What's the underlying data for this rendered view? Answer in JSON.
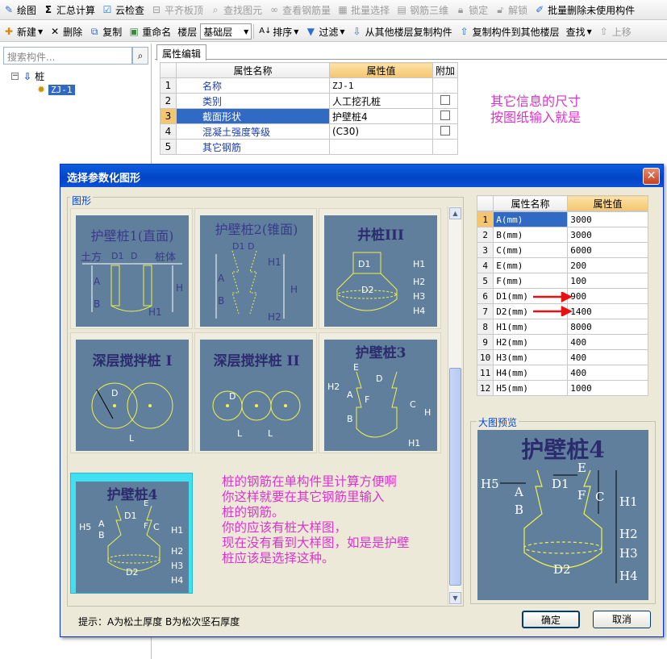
{
  "toolbar1": {
    "items": [
      {
        "label": "绘图",
        "icon": "draw-icon",
        "disabled": false
      },
      {
        "label": "汇总计算",
        "icon": "sigma-icon",
        "disabled": false
      },
      {
        "label": "云检查",
        "icon": "cloud-check-icon",
        "disabled": false
      },
      {
        "label": "平齐板顶",
        "icon": "align-top-icon",
        "disabled": true
      },
      {
        "label": "查找图元",
        "icon": "find-icon",
        "disabled": true
      },
      {
        "label": "查看钢筋量",
        "icon": "rebar-icon",
        "disabled": true
      },
      {
        "label": "批量选择",
        "icon": "batch-select-icon",
        "disabled": true
      },
      {
        "label": "钢筋三维",
        "icon": "rebar-3d-icon",
        "disabled": true
      },
      {
        "label": "锁定",
        "icon": "lock-icon",
        "disabled": true
      },
      {
        "label": "解锁",
        "icon": "unlock-icon",
        "disabled": true
      },
      {
        "label": "批量删除未使用构件",
        "icon": "batch-delete-icon",
        "disabled": false
      }
    ]
  },
  "toolbar2": {
    "new_label": "新建",
    "delete_label": "删除",
    "copy_label": "复制",
    "rename_label": "重命名",
    "floor_label": "楼层",
    "floor_value": "基础层",
    "sort_label": "排序",
    "filter_label": "过滤",
    "copy_from_label": "从其他楼层复制构件",
    "copy_to_label": "复制构件到其他楼层",
    "find_label": "查找",
    "up_label": "上移"
  },
  "left_panel": {
    "search_placeholder": "搜索构件...",
    "tree_root": "桩",
    "tree_child": "ZJ-1"
  },
  "main": {
    "tab_label": "属性编辑",
    "prop_headers": {
      "name": "属性名称",
      "value": "属性值",
      "extra": "附加"
    },
    "prop_rows": [
      {
        "num": "1",
        "name": "名称",
        "value": "ZJ-1"
      },
      {
        "num": "2",
        "name": "类别",
        "value": "人工挖孔桩"
      },
      {
        "num": "3",
        "name": "截面形状",
        "value": "护壁桩4"
      },
      {
        "num": "4",
        "name": "混凝土强度等级",
        "value": "(C30)"
      },
      {
        "num": "5",
        "name": "其它钢筋",
        "value": ""
      }
    ],
    "annotation": "其它信息的尺寸\n按图纸输入就是"
  },
  "dialog": {
    "title": "选择参数化图形",
    "shapes_label": "图形",
    "shapes": [
      {
        "title": "护壁桩1(直面)",
        "labels": [
          "土方",
          "D1",
          "D",
          "桩体",
          "A",
          "B",
          "H",
          "H1"
        ]
      },
      {
        "title": "护壁桩2(锥面)",
        "labels": [
          "D1",
          "D",
          "H1",
          "A",
          "B",
          "H",
          "H2"
        ]
      },
      {
        "title": "井桩III",
        "labels": [
          "D1",
          "D2",
          "H1",
          "H2",
          "H3",
          "H4"
        ]
      },
      {
        "title": "深层搅拌桩 I",
        "labels": [
          "D",
          "L"
        ]
      },
      {
        "title": "深层搅拌桩 II",
        "labels": [
          "D",
          "L",
          "L"
        ]
      },
      {
        "title": "护壁桩3",
        "labels": [
          "E",
          "D",
          "H2",
          "A",
          "F",
          "C",
          "B",
          "H",
          "H1"
        ]
      },
      {
        "title": "护壁桩4",
        "labels": [
          "E",
          "D1",
          "H5",
          "A",
          "F",
          "C",
          "B",
          "H1",
          "H2",
          "H3",
          "H4",
          "D2"
        ]
      }
    ],
    "annotation": "桩的钢筋在单构件里计算方便啊\n你这样就要在其它钢筋里输入\n桩的钢筋。\n你的应该有桩大样图，\n现在没有看到大样图，如是是护壁\n桩应该是选择这种。",
    "param_headers": {
      "name": "属性名称",
      "value": "属性值"
    },
    "params": [
      {
        "num": "1",
        "name": "A(mm)",
        "value": "3000"
      },
      {
        "num": "2",
        "name": "B(mm)",
        "value": "3000"
      },
      {
        "num": "3",
        "name": "C(mm)",
        "value": "6000"
      },
      {
        "num": "4",
        "name": "E(mm)",
        "value": "200"
      },
      {
        "num": "5",
        "name": "F(mm)",
        "value": "100"
      },
      {
        "num": "6",
        "name": "D1(mm)",
        "value": "900"
      },
      {
        "num": "7",
        "name": "D2(mm)",
        "value": "1400"
      },
      {
        "num": "8",
        "name": "H1(mm)",
        "value": "8000"
      },
      {
        "num": "9",
        "name": "H2(mm)",
        "value": "400"
      },
      {
        "num": "10",
        "name": "H3(mm)",
        "value": "400"
      },
      {
        "num": "11",
        "name": "H4(mm)",
        "value": "400"
      },
      {
        "num": "12",
        "name": "H5(mm)",
        "value": "1000"
      }
    ],
    "preview_label": "大图预览",
    "preview": {
      "title": "护壁桩4",
      "labels": [
        "E",
        "H5",
        "D1",
        "A",
        "F",
        "C",
        "B",
        "H1",
        "H2",
        "H3",
        "H4",
        "D2"
      ]
    },
    "hint": "提示：A为松土厚度  B为松次坚石厚度",
    "ok_label": "确定",
    "cancel_label": "取消"
  },
  "colors": {
    "annotation": "#dd33cc",
    "shape_bg": "#5f7f9c",
    "selected_card": "#41e0f0",
    "header_orange": "#f4c66d",
    "selection_blue": "#316ac5",
    "arrow_red": "#e81010"
  }
}
